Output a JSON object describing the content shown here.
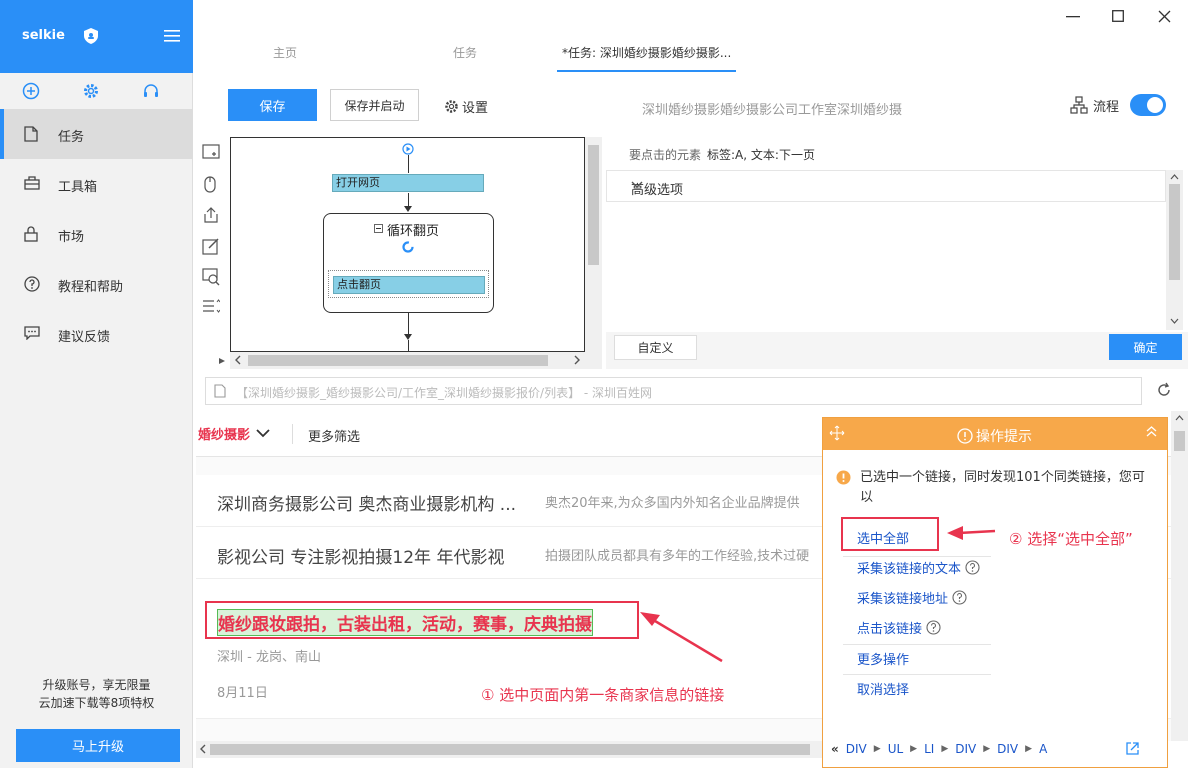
{
  "app": {
    "name": "selkie",
    "promo_text": "升级账号，享无限量\n云加速下载等8项特权",
    "upgrade_label": "马上升级"
  },
  "sidebar": {
    "items": [
      {
        "label": "任务",
        "icon": "document-icon",
        "active": true
      },
      {
        "label": "工具箱",
        "icon": "toolbox-icon"
      },
      {
        "label": "市场",
        "icon": "lock-icon"
      },
      {
        "label": "教程和帮助",
        "icon": "help-icon"
      },
      {
        "label": "建议反馈",
        "icon": "feedback-icon"
      }
    ]
  },
  "tabs": [
    {
      "label": "主页"
    },
    {
      "label": "任务"
    },
    {
      "label": "*任务: 深圳婚纱摄影婚纱摄影...",
      "active": true
    }
  ],
  "toolbar": {
    "save_label": "保存",
    "save_start_label": "保存并启动",
    "settings_label": "设置",
    "task_title": "深圳婚纱摄影婚纱摄影公司工作室深圳婚纱摄",
    "flow_label": "流程",
    "flow_on": true
  },
  "workflow": {
    "nodes": {
      "open_page": "打开网页",
      "loop": "循环翻页",
      "click_page": "点击翻页"
    }
  },
  "config": {
    "target_label": "要点击的元素",
    "target_value": "标签:A, 文本:下一页",
    "advanced_label": "高级选项",
    "custom_label": "自定义",
    "ok_label": "确定"
  },
  "browser": {
    "url": "【深圳婚纱摄影_婚纱摄影公司/工作室_深圳婚纱摄影报价/列表】 - 深圳百姓网",
    "filter_category": "婚纱摄影",
    "filter_more": "更多筛选",
    "listings": [
      {
        "title": "深圳商务摄影公司 奥杰商业摄影机构 ...",
        "desc": "奥杰20年来,为众多国内外知名企业品牌提供"
      },
      {
        "title": "影视公司 专注影视拍摄12年 年代影视",
        "desc": "拍摄团队成员都具有多年的工作经验,技术过硬"
      }
    ],
    "selected_link": "婚纱跟妆跟拍，古装出租，活动，赛事，庆典拍摄",
    "location": "深圳 - 龙岗、南山",
    "date": "8月11日",
    "annotation_1": "① 选中页面内第一条商家信息的链接"
  },
  "tips": {
    "title": "操作提示",
    "message": "已选中一个链接，同时发现101个同类链接，您可以",
    "options": {
      "select_all": "选中全部",
      "collect_text": "采集该链接的文本",
      "collect_url": "采集该链接地址",
      "click_link": "点击该链接",
      "more": "更多操作",
      "cancel": "取消选择"
    },
    "annotation_2": "② 选择“选中全部”",
    "breadcrumb": [
      "DIV",
      "UL",
      "LI",
      "DIV",
      "DIV",
      "A"
    ]
  },
  "colors": {
    "accent": "#2a8ff7",
    "highlight": "#e8344e",
    "tips_header": "#f7a84a",
    "link": "#1a55c9"
  }
}
